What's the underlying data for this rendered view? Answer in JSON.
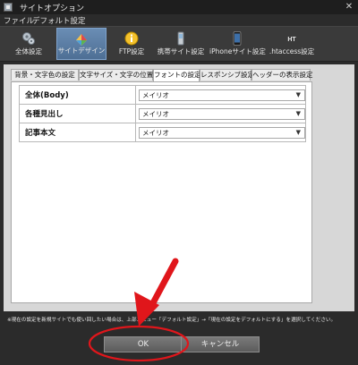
{
  "window": {
    "title": "サイトオプション",
    "close": "✕"
  },
  "menu": [
    "ファイル",
    "デフォルト設定"
  ],
  "toolbar": [
    {
      "label": "全体設定",
      "icon": "gears-icon"
    },
    {
      "label": "サイトデザイン",
      "icon": "palette-icon",
      "active": true
    },
    {
      "label": "FTP設定",
      "icon": "info-icon"
    },
    {
      "label": "携帯サイト設定",
      "icon": "mobile-phone-icon"
    },
    {
      "label": "iPhoneサイト設定",
      "icon": "iphone-icon"
    },
    {
      "label": ".htaccess設定",
      "icon": "ht-file-icon",
      "icon_text": "HT"
    }
  ],
  "tabs": [
    "背景・文字色の設定",
    "文字サイズ・文字の位置",
    "フォントの設定",
    "レスポンシブ設定",
    "ヘッダーの表示設定"
  ],
  "selected_tab": "フォントの設定",
  "font_settings": [
    {
      "label": "全体(Body)",
      "value": "メイリオ"
    },
    {
      "label": "各種見出し",
      "value": "メイリオ"
    },
    {
      "label": "記事本文",
      "value": "メイリオ"
    }
  ],
  "footer": {
    "note": "※現在の設定を新規サイトでも使い回したい場合は、上部メニュー「デフォルト設定」→「現在の設定をデフォルトにする」を選択してください。",
    "ok": "OK",
    "cancel": "キャンセル"
  },
  "annotation_color": "#e0161b"
}
